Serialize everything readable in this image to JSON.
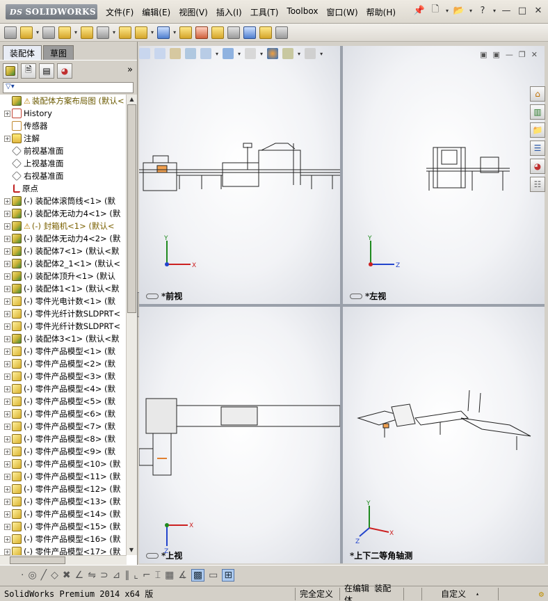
{
  "app": {
    "logo_prefix": "DS",
    "logo": "SOLIDWORKS"
  },
  "menu": [
    "文件(F)",
    "编辑(E)",
    "视图(V)",
    "插入(I)",
    "工具(T)",
    "Toolbox",
    "窗口(W)",
    "帮助(H)"
  ],
  "panel": {
    "tabs": [
      {
        "label": "装配体",
        "active": true
      },
      {
        "label": "草图",
        "active": false
      }
    ],
    "more": "»",
    "filter_icon": "funnel-icon"
  },
  "tree": [
    {
      "label": "装配体方案布局图 (默认<",
      "icon": "assembly",
      "warn": true,
      "exp": "",
      "top": true
    },
    {
      "label": "History",
      "icon": "history",
      "exp": "+"
    },
    {
      "label": "传感器",
      "icon": "sensor",
      "exp": ""
    },
    {
      "label": "注解",
      "icon": "note",
      "exp": "+"
    },
    {
      "label": "前视基准面",
      "icon": "plane",
      "exp": ""
    },
    {
      "label": "上视基准面",
      "icon": "plane",
      "exp": ""
    },
    {
      "label": "右视基准面",
      "icon": "plane",
      "exp": ""
    },
    {
      "label": "原点",
      "icon": "origin",
      "exp": ""
    },
    {
      "label": "(-) 装配体滚筒线<1> (默",
      "icon": "assembly",
      "exp": "+"
    },
    {
      "label": "(-) 装配体无动力4<1> (默",
      "icon": "assembly",
      "exp": "+"
    },
    {
      "label": "(-) 封箱机<1> (默认<",
      "icon": "assembly",
      "warn": true,
      "exp": "+"
    },
    {
      "label": "(-) 装配体无动力4<2> (默",
      "icon": "assembly",
      "exp": "+"
    },
    {
      "label": "(-) 装配体7<1> (默认<默",
      "icon": "assembly",
      "exp": "+"
    },
    {
      "label": "(-) 装配体2_1<1> (默认<",
      "icon": "assembly",
      "exp": "+"
    },
    {
      "label": "(-) 装配体顶升<1> (默认",
      "icon": "assembly",
      "exp": "+"
    },
    {
      "label": "(-) 装配体1<1> (默认<默",
      "icon": "assembly",
      "exp": "+"
    },
    {
      "label": "(-) 零件光电计数<1> (默",
      "icon": "part",
      "exp": "+"
    },
    {
      "label": "(-) 零件光纤计数SLDPRT<",
      "icon": "part",
      "exp": "+"
    },
    {
      "label": "(-) 零件光纤计数SLDPRT<",
      "icon": "part",
      "exp": "+"
    },
    {
      "label": "(-) 装配体3<1> (默认<默",
      "icon": "assembly",
      "exp": "+"
    },
    {
      "label": "(-) 零件产品模型<1> (默",
      "icon": "part",
      "exp": "+"
    },
    {
      "label": "(-) 零件产品模型<2> (默",
      "icon": "part",
      "exp": "+"
    },
    {
      "label": "(-) 零件产品模型<3> (默",
      "icon": "part",
      "exp": "+"
    },
    {
      "label": "(-) 零件产品模型<4> (默",
      "icon": "part",
      "exp": "+"
    },
    {
      "label": "(-) 零件产品模型<5> (默",
      "icon": "part",
      "exp": "+"
    },
    {
      "label": "(-) 零件产品模型<6> (默",
      "icon": "part",
      "exp": "+"
    },
    {
      "label": "(-) 零件产品模型<7> (默",
      "icon": "part",
      "exp": "+"
    },
    {
      "label": "(-) 零件产品模型<8> (默",
      "icon": "part",
      "exp": "+"
    },
    {
      "label": "(-) 零件产品模型<9> (默",
      "icon": "part",
      "exp": "+"
    },
    {
      "label": "(-) 零件产品模型<10> (默",
      "icon": "part",
      "exp": "+"
    },
    {
      "label": "(-) 零件产品模型<11> (默",
      "icon": "part",
      "exp": "+"
    },
    {
      "label": "(-) 零件产品模型<12> (默",
      "icon": "part",
      "exp": "+"
    },
    {
      "label": "(-) 零件产品模型<13> (默",
      "icon": "part",
      "exp": "+"
    },
    {
      "label": "(-) 零件产品模型<14> (默",
      "icon": "part",
      "exp": "+"
    },
    {
      "label": "(-) 零件产品模型<15> (默",
      "icon": "part",
      "exp": "+"
    },
    {
      "label": "(-) 零件产品模型<16> (默",
      "icon": "part",
      "exp": "+"
    },
    {
      "label": "(-) 零件产品模型<17> (默",
      "icon": "part",
      "exp": "+"
    }
  ],
  "viewports": {
    "front": {
      "label": "*前视",
      "axes": [
        "Y",
        "X"
      ]
    },
    "left": {
      "label": "*左视",
      "axes": [
        "Y",
        "Z"
      ]
    },
    "top": {
      "label": "*上视",
      "axes": [
        "X",
        "Z"
      ]
    },
    "iso": {
      "label": "*上下二等角轴测",
      "axes": [
        "Y",
        "X",
        "Z"
      ]
    }
  },
  "colors": {
    "axis_x": "#cc2020",
    "axis_y": "#1f8a1f",
    "axis_z": "#2244cc"
  },
  "status": {
    "product": "SolidWorks Premium 2014 x64 版",
    "defined": "完全定义",
    "editing": "在编辑 装配体",
    "units": "自定义"
  }
}
